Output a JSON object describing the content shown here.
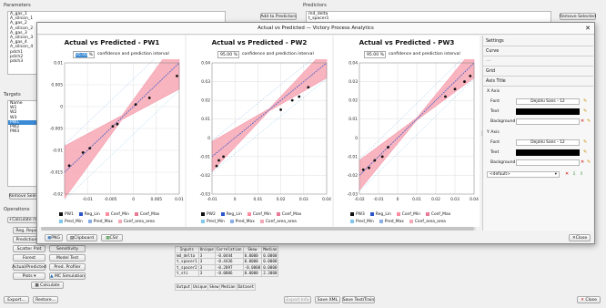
{
  "main": {
    "parameters_header": "Parameters",
    "predictors_header": "Predictors",
    "parameters": [
      "A_gas_1",
      "A_silicon_1",
      "A_gas_2",
      "A_silicon_2",
      "A_gas_3",
      "A_silicon_3",
      "A_gas_4",
      "A_silicon_4",
      "pdch1",
      "pdch2",
      "pdch3"
    ],
    "add_predictors": "Add to Predictors",
    "remove_selected_top": "Remove Selected",
    "predictors": [
      "md_delta",
      "t_spacer1"
    ],
    "targets_header": "Targets",
    "targets": [
      "Name",
      "W1",
      "W2",
      "W3",
      "PW1",
      "PW2",
      "PW3"
    ],
    "targets_selected_index": 4,
    "remove_selected_left": "Remove Selec",
    "operations_header": "Operations",
    "calc_button": "+Calculate m",
    "op_buttons": [
      "Reg. Repo",
      "Prediction",
      "Scatter Plot",
      "Sensitivity",
      "Forest",
      "Model Test",
      "Actual/Predicted",
      "Pred. Profiler",
      "Plots",
      "MC Simulation",
      "Calculate"
    ],
    "stats_table": {
      "headers": [
        "Inputs",
        "Unique",
        "Correlation",
        "Skew",
        "Median"
      ],
      "rows": [
        [
          "md_delta",
          "3",
          "-0.0444",
          "0.0000",
          "0.0000"
        ],
        [
          "t_spacer1",
          "3",
          "-0.4436",
          "0.0000",
          "0.0000"
        ],
        [
          "t_spacer2",
          "3",
          "-0.2097",
          "-0.0000",
          "0.0000"
        ],
        [
          "t_sti",
          "3",
          "-0.0006",
          "0.0000",
          "2.3000"
        ]
      ],
      "second_headers": [
        "Output",
        "Unique",
        "Skew",
        "Median",
        "Dataset"
      ]
    },
    "bottom": {
      "export": "Export...",
      "restore": "Restore...",
      "export_info": "Export Info",
      "save_xml": "Save XML",
      "save_text": "Save Text/Train",
      "close": "Close"
    }
  },
  "dialog": {
    "title": "Actual vs Predicted — Victory Process Analytics",
    "charts": [
      {
        "title": "Actual vs Predicted - PW1",
        "percent": "95.00",
        "percent_unit": "%",
        "interval_label": "confidence and prediction interval"
      },
      {
        "title": "Actual vs Predicted - PW2",
        "percent": "95.00",
        "percent_unit": "%",
        "interval_label": "confidence and prediction interval"
      },
      {
        "title": "Actual vs Predicted - PW3",
        "percent": "95.00",
        "percent_unit": "%",
        "interval_label": "confidence and prediction interval"
      }
    ],
    "legend": [
      "PW1",
      "Reg_Lin",
      "Conf_Min",
      "Conf_Max",
      "Pred_Min",
      "Pred_Max",
      "Conf_area_area"
    ],
    "legend_pw2": [
      "PW2",
      "Reg_Lin",
      "Conf_Min",
      "Conf_Max",
      "Pred_Min",
      "Pred_Max",
      "Conf_area_area"
    ],
    "legend_pw3": [
      "PW3",
      "Reg_Lin",
      "Conf_Min",
      "Conf_Max",
      "Pred_Min",
      "Pred_Max",
      "Conf_area_area"
    ],
    "export_buttons": [
      "PNG",
      "Clipboard",
      "CSV"
    ],
    "close_button": "Close",
    "settings": {
      "sections": [
        "Settings",
        "Curve",
        "Grid",
        "Axis Title"
      ],
      "x_axis": "X Axis",
      "y_axis": "Y Axis",
      "font_label": "Font",
      "font_value": "DejaVu Sans - 12",
      "text_label": "Text",
      "background_label": "Background",
      "default_option": "<default>",
      "text_color": "#000000",
      "dash_item": "---"
    }
  },
  "chart_data": [
    {
      "type": "scatter",
      "title": "Actual vs Predicted - PW1",
      "xlim": [
        -0.015,
        0.01
      ],
      "ylim": [
        -0.02,
        0.01
      ],
      "xticks": [
        -0.01,
        -0.005,
        0,
        0.005,
        0.01
      ],
      "yticks": [
        -0.02,
        -0.015,
        -0.01,
        -0.005,
        0,
        0.005,
        0.01
      ],
      "points": [
        [
          -0.014,
          -0.0135
        ],
        [
          -0.011,
          -0.0105
        ],
        [
          -0.0095,
          -0.0095
        ],
        [
          -0.0045,
          -0.0045
        ],
        [
          -0.0035,
          -0.004
        ],
        [
          0.0005,
          0.0005
        ],
        [
          0.0035,
          0.002
        ],
        [
          0.0095,
          0.007
        ]
      ],
      "reg_line": [
        [
          -0.015,
          -0.015
        ],
        [
          0.01,
          0.01
        ]
      ],
      "conf_halfwidth_ends": 0.006
    },
    {
      "type": "scatter",
      "title": "Actual vs Predicted - PW2",
      "xlim": [
        -0.01,
        0.04
      ],
      "ylim": [
        -0.03,
        0.04
      ],
      "xticks": [
        -0.01,
        0,
        0.01,
        0.02,
        0.03,
        0.04
      ],
      "yticks": [
        -0.03,
        -0.02,
        -0.01,
        0,
        0.01,
        0.02,
        0.03,
        0.04
      ],
      "points": [
        [
          -0.008,
          -0.015
        ],
        [
          -0.007,
          -0.012
        ],
        [
          -0.005,
          -0.01
        ],
        [
          0.02,
          0.015
        ],
        [
          0.025,
          0.02
        ],
        [
          0.028,
          0.022
        ],
        [
          0.032,
          0.027
        ]
      ],
      "reg_line": [
        [
          -0.01,
          -0.01
        ],
        [
          0.04,
          0.04
        ]
      ],
      "conf_halfwidth_ends": 0.008
    },
    {
      "type": "scatter",
      "title": "Actual vs Predicted - PW3",
      "xlim": [
        -0.02,
        0.04
      ],
      "ylim": [
        -0.03,
        0.04
      ],
      "xticks": [
        -0.02,
        -0.01,
        0,
        0.01,
        0.02,
        0.03,
        0.04
      ],
      "yticks": [
        -0.03,
        -0.02,
        -0.01,
        0,
        0.01,
        0.02,
        0.03,
        0.04
      ],
      "points": [
        [
          -0.018,
          -0.017
        ],
        [
          -0.015,
          -0.016
        ],
        [
          -0.012,
          -0.012
        ],
        [
          -0.008,
          -0.01
        ],
        [
          -0.005,
          -0.005
        ],
        [
          0.025,
          0.022
        ],
        [
          0.03,
          0.026
        ],
        [
          0.035,
          0.03
        ],
        [
          0.038,
          0.033
        ]
      ],
      "reg_line": [
        [
          -0.02,
          -0.02
        ],
        [
          0.04,
          0.04
        ]
      ],
      "conf_halfwidth_ends": 0.008
    }
  ]
}
